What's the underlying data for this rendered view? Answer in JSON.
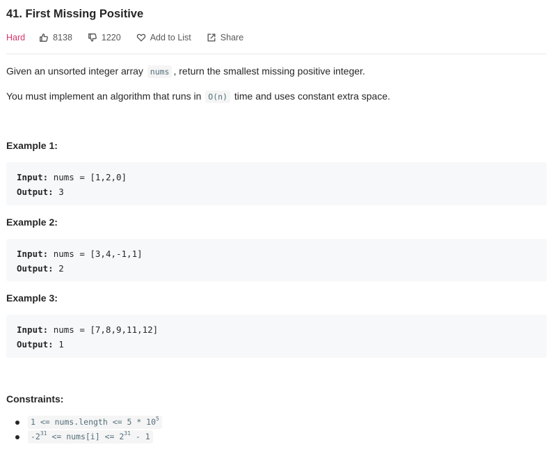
{
  "problem": {
    "title": "41. First Missing Positive",
    "difficulty": "Hard",
    "likes": "8138",
    "dislikes": "1220",
    "add_to_list_label": "Add to List",
    "share_label": "Share"
  },
  "description": {
    "p1_before": "Given an unsorted integer array",
    "p1_code": "nums",
    "p1_after": ", return the smallest missing positive integer.",
    "p2_before": "You must implement an algorithm that runs in",
    "p2_code": "O(n)",
    "p2_after": "time and uses constant extra space."
  },
  "examples": [
    {
      "title": "Example 1:",
      "input_label": "Input:",
      "input": "nums = [1,2,0]",
      "output_label": "Output:",
      "output": "3"
    },
    {
      "title": "Example 2:",
      "input_label": "Input:",
      "input": "nums = [3,4,-1,1]",
      "output_label": "Output:",
      "output": "2"
    },
    {
      "title": "Example 3:",
      "input_label": "Input:",
      "input": "nums = [7,8,9,11,12]",
      "output_label": "Output:",
      "output": "1"
    }
  ],
  "constraints": {
    "title": "Constraints:",
    "c1_main": "1 <= nums.length <= 5 * 10",
    "c1_sup": "5",
    "c2_pre": "-2",
    "c2_sup1": "31",
    "c2_mid": " <= nums[i] <= 2",
    "c2_sup2": "31",
    "c2_post": " - 1"
  },
  "colors": {
    "difficulty_hard": "#d6336c",
    "code_bg": "#f7f8fa",
    "inline_code_text": "#546e7a"
  },
  "icons": {
    "like": "thumbs-up-icon",
    "dislike": "thumbs-down-icon",
    "add_to_list": "heart-icon",
    "share": "share-icon"
  }
}
